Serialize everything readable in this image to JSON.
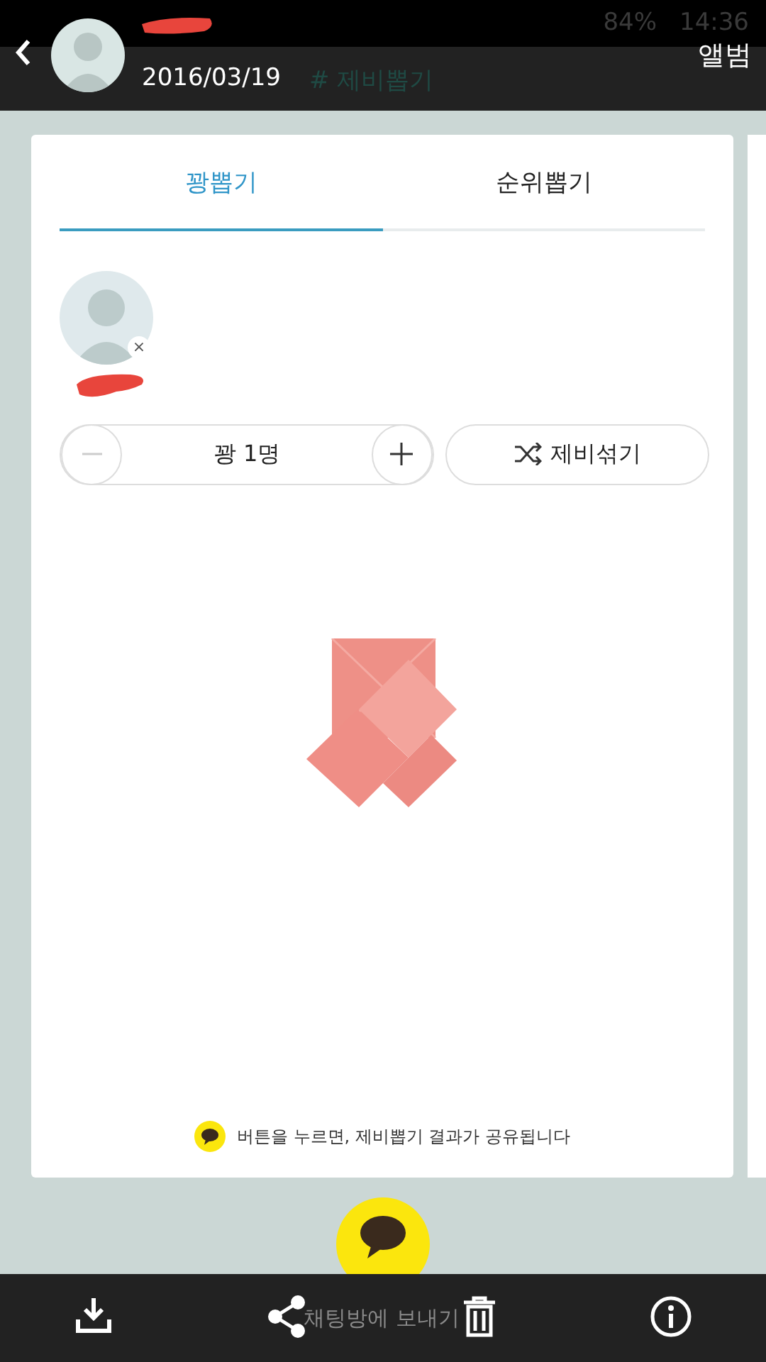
{
  "status_bar": {
    "battery": "84%",
    "time": "14:36"
  },
  "header": {
    "date": "2016/03/19",
    "title": "# 제비뽑기",
    "album": "앨범",
    "name_redacted": true
  },
  "tabs": [
    {
      "label": "꽝뽑기",
      "selected": true
    },
    {
      "label": "순위뽑기",
      "selected": false
    }
  ],
  "participants": [
    {
      "kind": "redacted",
      "remove": "×"
    }
  ],
  "counter": {
    "label": "꽝 1명"
  },
  "shuffle": {
    "label": "제비섞기"
  },
  "notice": "버튼을 누르면, 제비뽑기 결과가 공유됩니다",
  "send_label": "채팅방에 보내기"
}
